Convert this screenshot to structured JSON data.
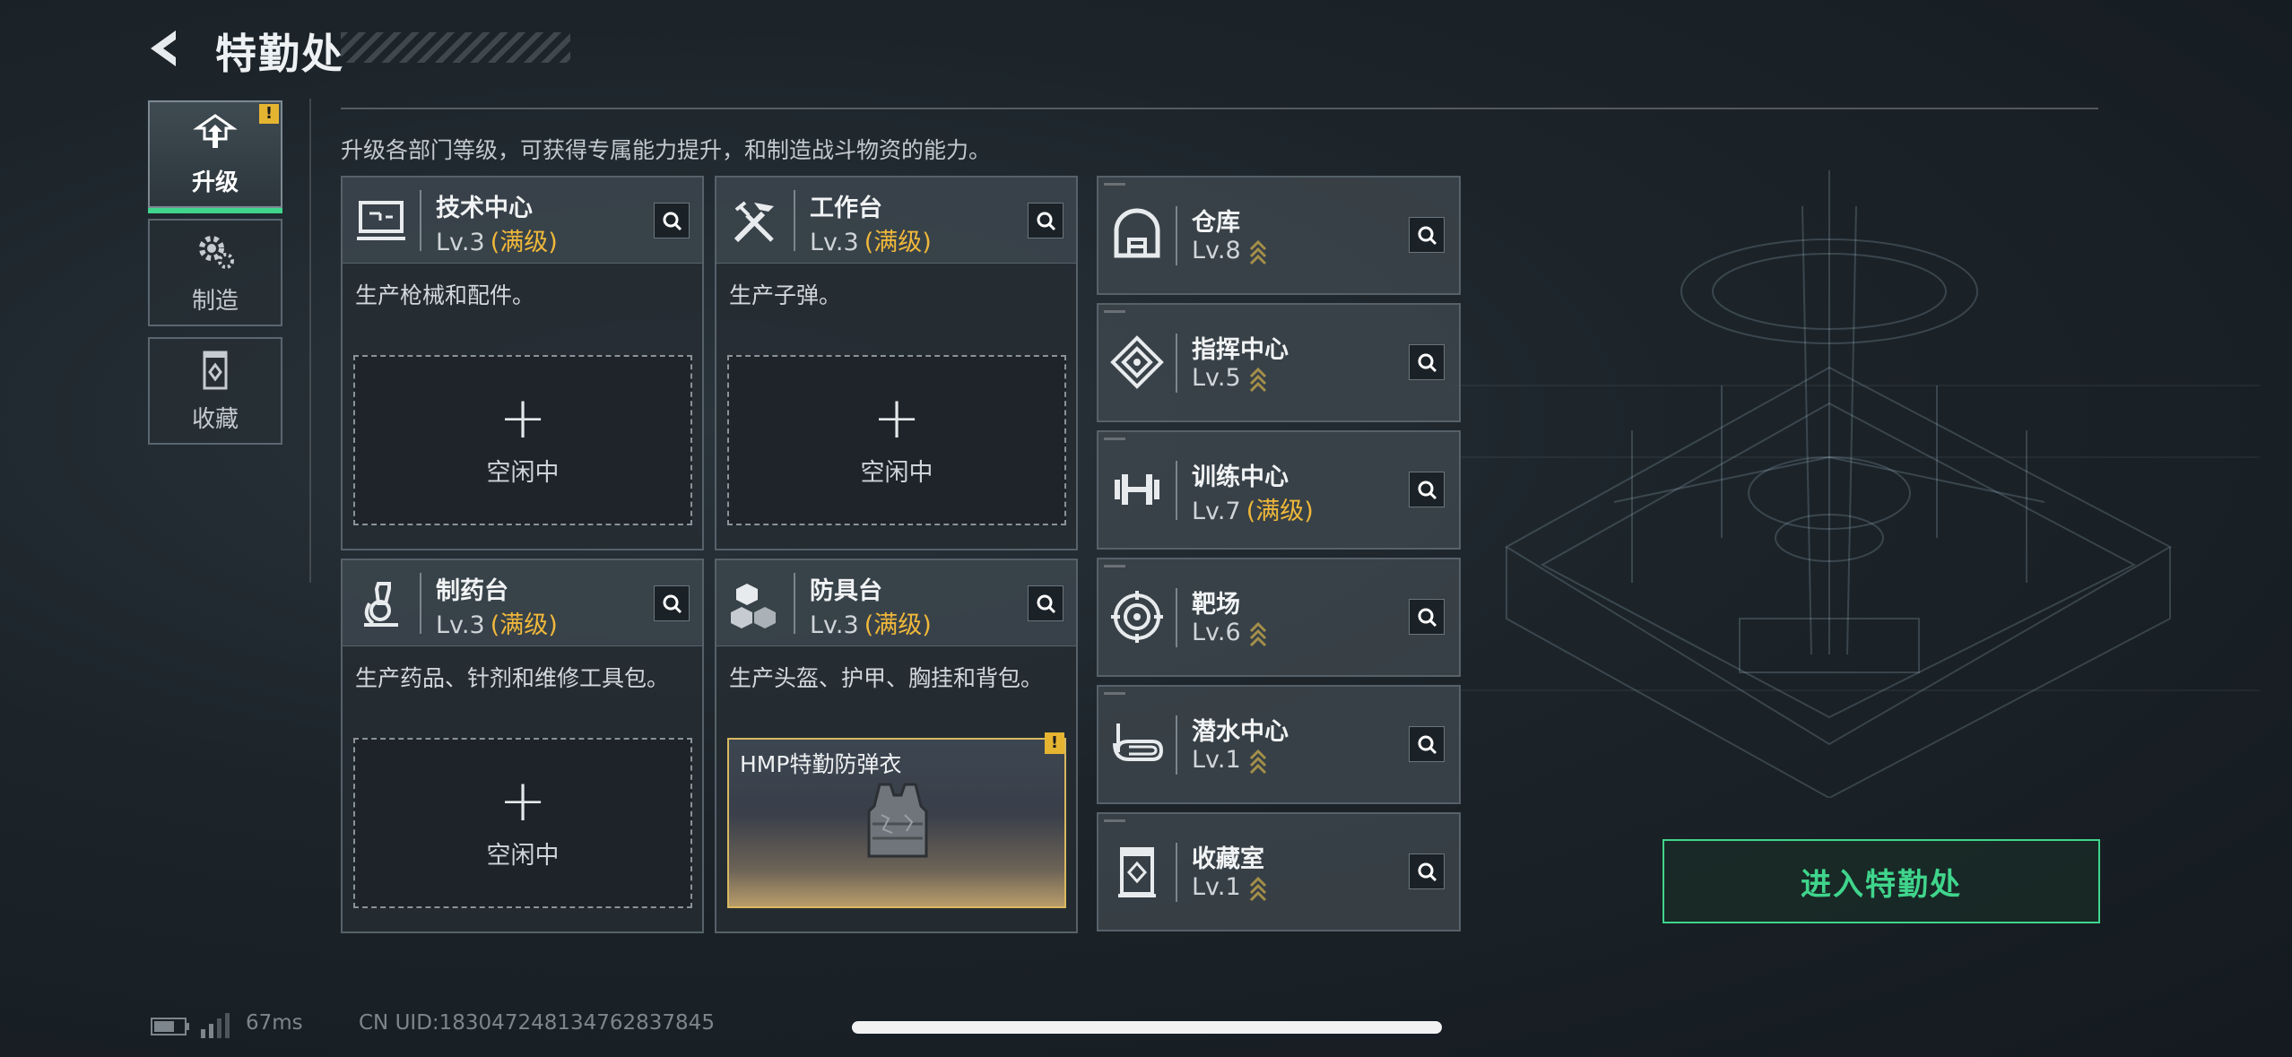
{
  "header": {
    "title": "特勤处",
    "back_icon": "back-arrow-icon"
  },
  "tabs": [
    {
      "label": "升级",
      "icon": "upgrade-icon",
      "active": true,
      "alert": "!"
    },
    {
      "label": "制造",
      "icon": "gear-icon",
      "active": false
    },
    {
      "label": "收藏",
      "icon": "collection-icon",
      "active": false
    }
  ],
  "description": "升级各部门等级，可获得专属能力提升，和制造战斗物资的能力。",
  "workshops": [
    {
      "name": "技术中心",
      "level": "Lv.3",
      "max": "(满级)",
      "desc": "生产枪械和配件。",
      "icon": "computer-icon",
      "slot": {
        "plus": "+",
        "status": "空闲中"
      }
    },
    {
      "name": "工作台",
      "level": "Lv.3",
      "max": "(满级)",
      "desc": "生产子弹。",
      "icon": "tools-icon",
      "slot": {
        "plus": "+",
        "status": "空闲中"
      }
    },
    {
      "name": "制药台",
      "level": "Lv.3",
      "max": "(满级)",
      "desc": "生产药品、针剂和维修工具包。",
      "icon": "microscope-icon",
      "slot": {
        "plus": "+",
        "status": "空闲中"
      }
    },
    {
      "name": "防具台",
      "level": "Lv.3",
      "max": "(满级)",
      "desc": "生产头盔、护甲、胸挂和背包。",
      "icon": "armor-icon",
      "item": {
        "name": "HMP特勤防弹衣",
        "alert": "!"
      }
    }
  ],
  "facilities": [
    {
      "name": "仓库",
      "level": "Lv.8",
      "max": "",
      "icon": "warehouse-icon",
      "upgradeable": true
    },
    {
      "name": "指挥中心",
      "level": "Lv.5",
      "max": "",
      "icon": "command-icon",
      "upgradeable": true
    },
    {
      "name": "训练中心",
      "level": "Lv.7",
      "max": "(满级)",
      "icon": "dumbbell-icon",
      "upgradeable": false
    },
    {
      "name": "靶场",
      "level": "Lv.6",
      "max": "",
      "icon": "target-icon",
      "upgradeable": true
    },
    {
      "name": "潜水中心",
      "level": "Lv.1",
      "max": "",
      "icon": "diving-mask-icon",
      "upgradeable": true
    },
    {
      "name": "收藏室",
      "level": "Lv.1",
      "max": "",
      "icon": "collection-room-icon",
      "upgradeable": true
    }
  ],
  "enter_button": "进入特勤处",
  "status": {
    "ping": "67ms",
    "uid": "CN UID:1830472481347628378​45"
  },
  "colors": {
    "accent": "#3fd58c",
    "max_level": "#f0b83a",
    "alert": "#e5b532"
  }
}
